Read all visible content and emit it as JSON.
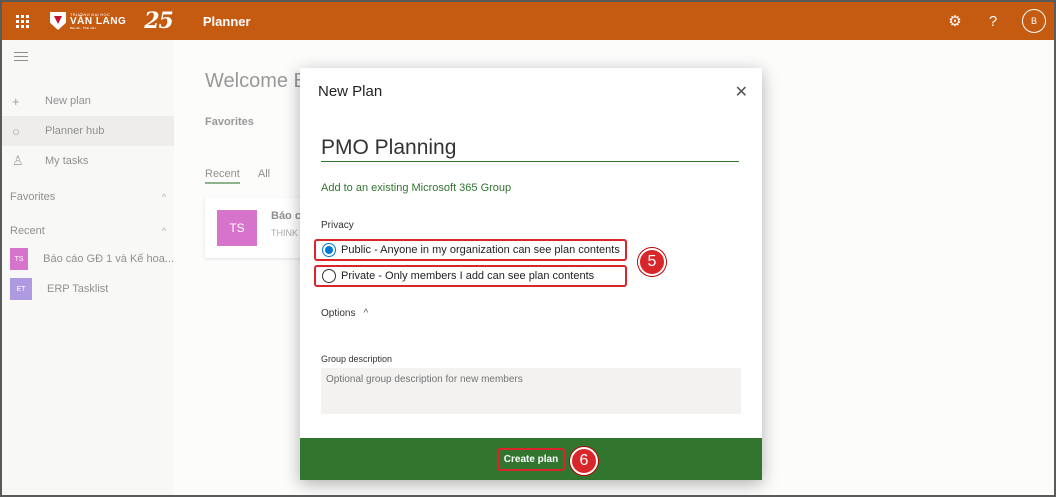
{
  "topbar": {
    "logo_small": "TRƯỜNG ĐẠI HỌC",
    "logo_big": "VĂN LANG",
    "logo_tag": "Bảo tồn · Phát triển",
    "anniversary": "25",
    "app_name": "Planner",
    "settings_icon": "⚙",
    "help_icon": "?",
    "avatar_initial": "B"
  },
  "sidebar": {
    "nav": [
      {
        "icon": "+",
        "label": "New plan"
      },
      {
        "icon": "○",
        "label": "Planner hub"
      },
      {
        "icon": "♙",
        "label": "My tasks"
      }
    ],
    "favorites_label": "Favorites",
    "recent_label": "Recent",
    "chevron": "^",
    "recent": [
      {
        "badge": "TS",
        "label": "Báo cáo GĐ 1 và Kế hoa...",
        "color": "#b4009e"
      },
      {
        "badge": "ET",
        "label": "ERP Tasklist",
        "color": "#6b47c9"
      }
    ]
  },
  "main": {
    "welcome": "Welcome B",
    "favorites": "Favorites",
    "tabs": [
      "Recent",
      "All"
    ],
    "card": {
      "badge": "TS",
      "title": "Báo cá",
      "subtitle": "THINK"
    }
  },
  "dialog": {
    "title": "New Plan",
    "close": "✕",
    "plan_name": "PMO Planning",
    "add_group": "Add to an existing Microsoft 365 Group",
    "privacy_label": "Privacy",
    "public": "Public - Anyone in my organization can see plan contents",
    "private": "Private - Only members I add can see plan contents",
    "options": "Options",
    "options_chevron": "^",
    "group_desc_label": "Group description",
    "group_desc_placeholder": "Optional group description for new members",
    "create": "Create plan"
  },
  "steps": {
    "five": "5",
    "six": "6"
  },
  "colors": {
    "brand": "#c55a11",
    "accent": "#31752f",
    "highlight": "#d9262b",
    "radio": "#0078d4"
  }
}
